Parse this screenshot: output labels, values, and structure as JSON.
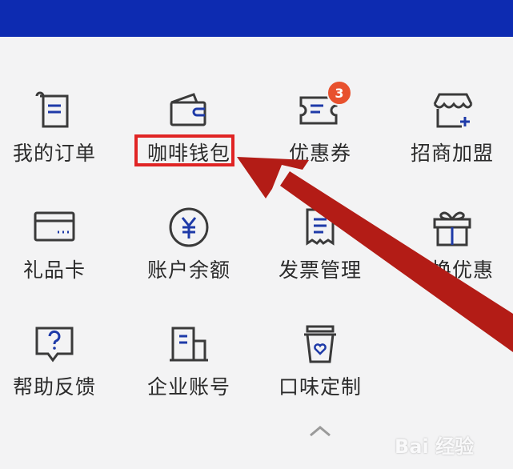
{
  "colors": {
    "top_bar": "#0d2bb1",
    "icon_stroke": "#3a3a3a",
    "icon_accent": "#1e3aa8",
    "badge": "#e8512e",
    "highlight_box": "#e02424",
    "arrow": "#b31c16"
  },
  "menu": {
    "row1": [
      {
        "label": "我的订单",
        "icon": "order-icon"
      },
      {
        "label": "咖啡钱包",
        "icon": "wallet-icon"
      },
      {
        "label": "优惠券",
        "icon": "coupon-icon",
        "badge": "3"
      },
      {
        "label": "招商加盟",
        "icon": "store-icon"
      }
    ],
    "row2": [
      {
        "label": "礼品卡",
        "icon": "gift-card-icon"
      },
      {
        "label": "账户余额",
        "icon": "yuan-icon"
      },
      {
        "label": "发票管理",
        "icon": "invoice-icon"
      },
      {
        "label": "兑换优惠",
        "icon": "gift-box-icon"
      }
    ],
    "row3": [
      {
        "label": "帮助反馈",
        "icon": "help-icon"
      },
      {
        "label": "企业账号",
        "icon": "building-icon"
      },
      {
        "label": "口味定制",
        "icon": "cup-heart-icon"
      }
    ]
  },
  "watermark": {
    "text": "Bai 经验"
  }
}
